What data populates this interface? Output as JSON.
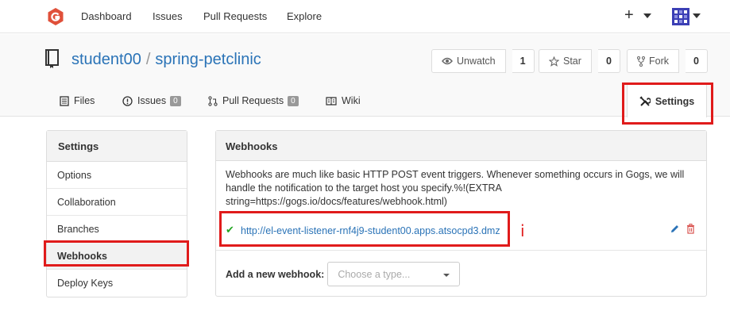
{
  "topnav": {
    "items": [
      "Dashboard",
      "Issues",
      "Pull Requests",
      "Explore"
    ],
    "plus_label": "+"
  },
  "repo": {
    "owner": "student00",
    "separator": "/",
    "name": "spring-petclinic"
  },
  "actions": {
    "watch_label": "Unwatch",
    "watch_count": "1",
    "star_label": "Star",
    "star_count": "0",
    "fork_label": "Fork",
    "fork_count": "0"
  },
  "tabs": {
    "files": "Files",
    "issues": "Issues",
    "issues_count": "0",
    "pulls": "Pull Requests",
    "pulls_count": "0",
    "wiki": "Wiki",
    "settings": "Settings"
  },
  "sidebar": {
    "title": "Settings",
    "items": [
      "Options",
      "Collaboration",
      "Branches",
      "Webhooks",
      "Deploy Keys"
    ]
  },
  "webhooks": {
    "title": "Webhooks",
    "description": "Webhooks are much like basic HTTP POST event triggers. Whenever something occurs in Gogs, we will handle the notification to the target host you specify.%!(EXTRA string=https://gogs.io/docs/features/webhook.html)",
    "hook_url": "http://el-event-listener-rnf4j9-student00.apps.atsocpd3.dmz",
    "add_label": "Add a new webhook:",
    "select_placeholder": "Choose a type..."
  },
  "annotation": {
    "mark": "i"
  },
  "colors": {
    "link": "#2a73b7",
    "highlight": "#e01b1b",
    "success": "#21a521",
    "logo": "#e0503a"
  },
  "icons": [
    "gogs-logo-icon",
    "plus-icon",
    "avatar-icon",
    "repo-book-icon",
    "eye-icon",
    "star-icon",
    "fork-icon",
    "files-icon",
    "issue-icon",
    "pull-request-icon",
    "wiki-icon",
    "tools-icon",
    "check-icon",
    "pencil-icon",
    "trash-icon"
  ]
}
